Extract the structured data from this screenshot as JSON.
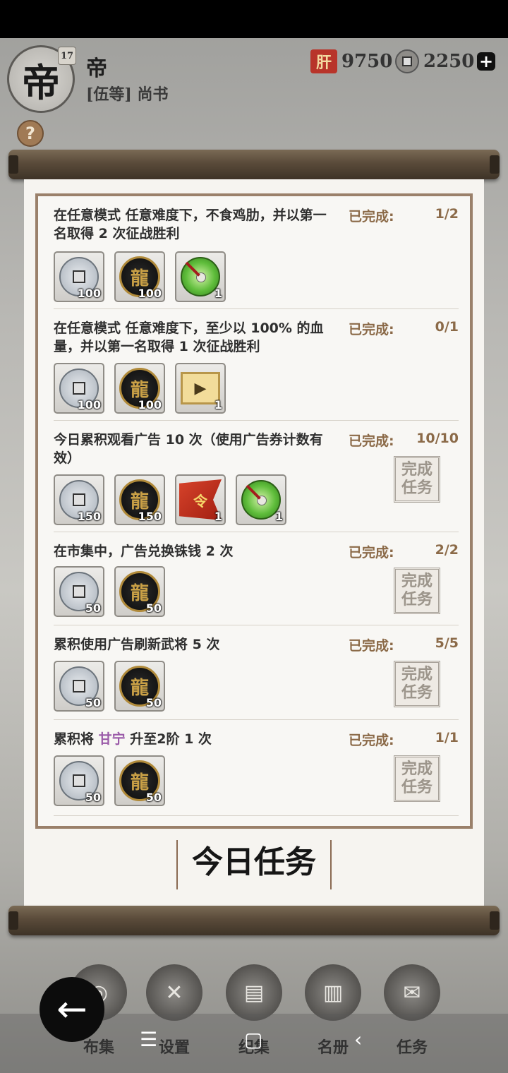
{
  "header": {
    "avatar_glyph": "帝",
    "level": "17",
    "name": "帝",
    "rank": "[伍等] 尚书",
    "currency_a_icon": "肝",
    "currency_a": "9750",
    "currency_b": "2250",
    "add_label": "+",
    "help_label": "?"
  },
  "tasks": [
    {
      "desc": "在任意模式 任意难度下，不食鸡肋，并以第一名取得 2 次征战胜利",
      "status_label": "已完成:",
      "progress": "1/2",
      "rewards": [
        {
          "icon": "silver-coin",
          "count": "100"
        },
        {
          "icon": "gold-coin",
          "count": "100"
        },
        {
          "icon": "jade-disc",
          "count": "1"
        }
      ]
    },
    {
      "desc": "在任意模式 任意难度下，至少以 100% 的血量，并以第一名取得 1 次征战胜利",
      "status_label": "已完成:",
      "progress": "0/1",
      "rewards": [
        {
          "icon": "silver-coin",
          "count": "100"
        },
        {
          "icon": "gold-coin",
          "count": "100"
        },
        {
          "icon": "ad-ticket",
          "count": "1"
        }
      ]
    },
    {
      "desc": "今日累积观看广告 10 次（使用广告券计数有效）",
      "status_label": "已完成:",
      "progress": "10/10",
      "stamp": "完成任务",
      "rewards": [
        {
          "icon": "silver-coin",
          "count": "150"
        },
        {
          "icon": "gold-coin",
          "count": "150"
        },
        {
          "icon": "order-flag",
          "count": "1"
        },
        {
          "icon": "jade-disc",
          "count": "1"
        }
      ]
    },
    {
      "desc": "在市集中，广告兑换铢钱 2 次",
      "status_label": "已完成:",
      "progress": "2/2",
      "stamp": "完成任务",
      "rewards": [
        {
          "icon": "silver-coin",
          "count": "50"
        },
        {
          "icon": "gold-coin",
          "count": "50"
        }
      ]
    },
    {
      "desc": "累积使用广告刷新武将 5 次",
      "status_label": "已完成:",
      "progress": "5/5",
      "stamp": "完成任务",
      "rewards": [
        {
          "icon": "silver-coin",
          "count": "50"
        },
        {
          "icon": "gold-coin",
          "count": "50"
        }
      ]
    },
    {
      "desc_pre": "累积将 ",
      "desc_hl": "甘宁",
      "desc_post": " 升至2阶 1 次",
      "status_label": "已完成:",
      "progress": "1/1",
      "stamp": "完成任务",
      "rewards": [
        {
          "icon": "silver-coin",
          "count": "50"
        },
        {
          "icon": "gold-coin",
          "count": "50"
        }
      ]
    }
  ],
  "stamp_lines": [
    "完成",
    "任务"
  ],
  "daily_title": "今日任务",
  "nav": [
    {
      "label": "布集",
      "icon": "coins-icon"
    },
    {
      "label": "设置",
      "icon": "settings-icon"
    },
    {
      "label": "纪集",
      "icon": "book-icon"
    },
    {
      "label": "名册",
      "icon": "roster-icon"
    },
    {
      "label": "任务",
      "icon": "scroll-icon"
    }
  ],
  "back_label": "←",
  "system": {
    "menu": "☰",
    "home": "▢",
    "back": "‹"
  },
  "colors": {
    "accent": "#8b6a48",
    "highlight": "#9a5aa8",
    "frame": "#9a806a"
  }
}
